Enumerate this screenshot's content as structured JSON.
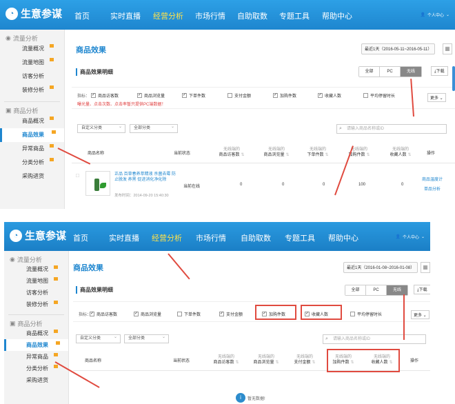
{
  "shot1": {
    "app_name": "生意参谋",
    "nav": [
      "首页",
      "实时直播",
      "经营分析",
      "市场行情",
      "自助取数",
      "专题工具",
      "帮助中心"
    ],
    "active_nav": "经营分析",
    "user_label": "个人中心",
    "sidebar": {
      "group1": "流量分析",
      "group1_items": [
        "流量概况",
        "流量地图",
        "访客分析",
        "装修分析"
      ],
      "group2": "商品分析",
      "group2_items": [
        "商品概况",
        "商品效果",
        "异常商品",
        "分类分析",
        "采购进货"
      ],
      "active": "商品效果"
    },
    "page_title": "商品效果",
    "date_range": "最近1天（2016-05-11~2016-05-11）",
    "section_title": "商品效果明细",
    "device_tabs": [
      "全部",
      "PC",
      "无线"
    ],
    "active_device": "无线",
    "download_label": "下载",
    "metrics_label": "指标：",
    "metrics": [
      {
        "label": "商品访客数",
        "checked": true
      },
      {
        "label": "商品浏览量",
        "checked": true
      },
      {
        "label": "下单件数",
        "checked": true
      },
      {
        "label": "支付金额",
        "checked": false
      },
      {
        "label": "加购件数",
        "checked": true
      },
      {
        "label": "收藏人数",
        "checked": true
      },
      {
        "label": "平均停留时长",
        "checked": false
      }
    ],
    "metrics_note": "曝光量、点击次数、点击率暂只提供PC端数据！",
    "more_label": "更多",
    "filter1": "自定义分类",
    "filter2": "全部分类",
    "search_placeholder": "请输入商品名称或ID",
    "table_headers": {
      "name": "商品名称",
      "status": "当前状态",
      "sub": "无线端的",
      "col1": "商品访客数",
      "col2": "商品浏览量",
      "col3": "下单件数",
      "col4": "加购件数",
      "col5": "收藏人数",
      "ops": "操作"
    },
    "row": {
      "name": "正品 百草春养萃精液 杀菌去霉 防止脱发 养黑 促进消化净化除",
      "publish_time": "发布时间：2014-09-20 15:40:30",
      "status": "当前在线",
      "values": [
        "0",
        "0",
        "0",
        "100",
        "0"
      ],
      "op1": "商品温度计",
      "op2": "单品分析"
    }
  },
  "shot2": {
    "app_name": "生意参谋",
    "nav": [
      "首页",
      "实时直播",
      "经营分析",
      "市场行情",
      "自助取数",
      "专题工具",
      "帮助中心"
    ],
    "active_nav": "经营分析",
    "user_label": "个人中心",
    "sidebar": {
      "group1": "流量分析",
      "group1_items": [
        "流量概况",
        "流量地图",
        "访客分析",
        "装修分析"
      ],
      "group2": "商品分析",
      "group2_items": [
        "商品概况",
        "商品效果",
        "异常商品",
        "分类分析",
        "采购进货"
      ],
      "active": "商品效果"
    },
    "page_title": "商品效果",
    "date_range": "最近1天（2016-01-08~2016-01-08）",
    "section_title": "商品效果明细",
    "device_tabs": [
      "全部",
      "PC",
      "无线"
    ],
    "active_device": "无线",
    "download_label": "下载",
    "metrics_label": "指标：",
    "metrics": [
      {
        "label": "商品访客数",
        "checked": true
      },
      {
        "label": "商品浏览量",
        "checked": true
      },
      {
        "label": "下单件数",
        "checked": false
      },
      {
        "label": "支付金额",
        "checked": true
      },
      {
        "label": "加购件数",
        "checked": true
      },
      {
        "label": "收藏人数",
        "checked": true
      },
      {
        "label": "平均停留时长",
        "checked": false
      }
    ],
    "more_label": "更多",
    "filter1": "自定义分类",
    "filter2": "全部分类",
    "search_placeholder": "请输入商品名称或ID",
    "table_headers": {
      "name": "商品名称",
      "status": "当前状态",
      "sub": "无线端的",
      "col1": "商品访客数",
      "col2": "商品浏览量",
      "col3": "支付金额",
      "col4": "加购件数",
      "col5": "收藏人数",
      "ops": "操作"
    },
    "empty_text": "暂无数据!"
  },
  "colors": {
    "brand": "#1e86cf",
    "annotation": "#e04a3f",
    "nav_active": "#ffe24a"
  }
}
